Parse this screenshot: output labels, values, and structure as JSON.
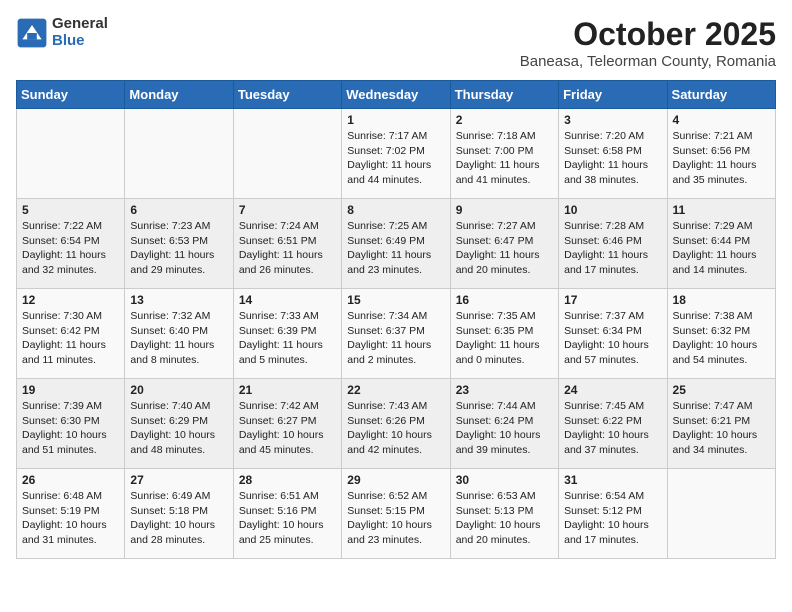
{
  "header": {
    "logo_general": "General",
    "logo_blue": "Blue",
    "title": "October 2025",
    "subtitle": "Baneasa, Teleorman County, Romania"
  },
  "weekdays": [
    "Sunday",
    "Monday",
    "Tuesday",
    "Wednesday",
    "Thursday",
    "Friday",
    "Saturday"
  ],
  "weeks": [
    [
      {
        "day": "",
        "info": ""
      },
      {
        "day": "",
        "info": ""
      },
      {
        "day": "",
        "info": ""
      },
      {
        "day": "1",
        "info": "Sunrise: 7:17 AM\nSunset: 7:02 PM\nDaylight: 11 hours\nand 44 minutes."
      },
      {
        "day": "2",
        "info": "Sunrise: 7:18 AM\nSunset: 7:00 PM\nDaylight: 11 hours\nand 41 minutes."
      },
      {
        "day": "3",
        "info": "Sunrise: 7:20 AM\nSunset: 6:58 PM\nDaylight: 11 hours\nand 38 minutes."
      },
      {
        "day": "4",
        "info": "Sunrise: 7:21 AM\nSunset: 6:56 PM\nDaylight: 11 hours\nand 35 minutes."
      }
    ],
    [
      {
        "day": "5",
        "info": "Sunrise: 7:22 AM\nSunset: 6:54 PM\nDaylight: 11 hours\nand 32 minutes."
      },
      {
        "day": "6",
        "info": "Sunrise: 7:23 AM\nSunset: 6:53 PM\nDaylight: 11 hours\nand 29 minutes."
      },
      {
        "day": "7",
        "info": "Sunrise: 7:24 AM\nSunset: 6:51 PM\nDaylight: 11 hours\nand 26 minutes."
      },
      {
        "day": "8",
        "info": "Sunrise: 7:25 AM\nSunset: 6:49 PM\nDaylight: 11 hours\nand 23 minutes."
      },
      {
        "day": "9",
        "info": "Sunrise: 7:27 AM\nSunset: 6:47 PM\nDaylight: 11 hours\nand 20 minutes."
      },
      {
        "day": "10",
        "info": "Sunrise: 7:28 AM\nSunset: 6:46 PM\nDaylight: 11 hours\nand 17 minutes."
      },
      {
        "day": "11",
        "info": "Sunrise: 7:29 AM\nSunset: 6:44 PM\nDaylight: 11 hours\nand 14 minutes."
      }
    ],
    [
      {
        "day": "12",
        "info": "Sunrise: 7:30 AM\nSunset: 6:42 PM\nDaylight: 11 hours\nand 11 minutes."
      },
      {
        "day": "13",
        "info": "Sunrise: 7:32 AM\nSunset: 6:40 PM\nDaylight: 11 hours\nand 8 minutes."
      },
      {
        "day": "14",
        "info": "Sunrise: 7:33 AM\nSunset: 6:39 PM\nDaylight: 11 hours\nand 5 minutes."
      },
      {
        "day": "15",
        "info": "Sunrise: 7:34 AM\nSunset: 6:37 PM\nDaylight: 11 hours\nand 2 minutes."
      },
      {
        "day": "16",
        "info": "Sunrise: 7:35 AM\nSunset: 6:35 PM\nDaylight: 11 hours\nand 0 minutes."
      },
      {
        "day": "17",
        "info": "Sunrise: 7:37 AM\nSunset: 6:34 PM\nDaylight: 10 hours\nand 57 minutes."
      },
      {
        "day": "18",
        "info": "Sunrise: 7:38 AM\nSunset: 6:32 PM\nDaylight: 10 hours\nand 54 minutes."
      }
    ],
    [
      {
        "day": "19",
        "info": "Sunrise: 7:39 AM\nSunset: 6:30 PM\nDaylight: 10 hours\nand 51 minutes."
      },
      {
        "day": "20",
        "info": "Sunrise: 7:40 AM\nSunset: 6:29 PM\nDaylight: 10 hours\nand 48 minutes."
      },
      {
        "day": "21",
        "info": "Sunrise: 7:42 AM\nSunset: 6:27 PM\nDaylight: 10 hours\nand 45 minutes."
      },
      {
        "day": "22",
        "info": "Sunrise: 7:43 AM\nSunset: 6:26 PM\nDaylight: 10 hours\nand 42 minutes."
      },
      {
        "day": "23",
        "info": "Sunrise: 7:44 AM\nSunset: 6:24 PM\nDaylight: 10 hours\nand 39 minutes."
      },
      {
        "day": "24",
        "info": "Sunrise: 7:45 AM\nSunset: 6:22 PM\nDaylight: 10 hours\nand 37 minutes."
      },
      {
        "day": "25",
        "info": "Sunrise: 7:47 AM\nSunset: 6:21 PM\nDaylight: 10 hours\nand 34 minutes."
      }
    ],
    [
      {
        "day": "26",
        "info": "Sunrise: 6:48 AM\nSunset: 5:19 PM\nDaylight: 10 hours\nand 31 minutes."
      },
      {
        "day": "27",
        "info": "Sunrise: 6:49 AM\nSunset: 5:18 PM\nDaylight: 10 hours\nand 28 minutes."
      },
      {
        "day": "28",
        "info": "Sunrise: 6:51 AM\nSunset: 5:16 PM\nDaylight: 10 hours\nand 25 minutes."
      },
      {
        "day": "29",
        "info": "Sunrise: 6:52 AM\nSunset: 5:15 PM\nDaylight: 10 hours\nand 23 minutes."
      },
      {
        "day": "30",
        "info": "Sunrise: 6:53 AM\nSunset: 5:13 PM\nDaylight: 10 hours\nand 20 minutes."
      },
      {
        "day": "31",
        "info": "Sunrise: 6:54 AM\nSunset: 5:12 PM\nDaylight: 10 hours\nand 17 minutes."
      },
      {
        "day": "",
        "info": ""
      }
    ]
  ]
}
